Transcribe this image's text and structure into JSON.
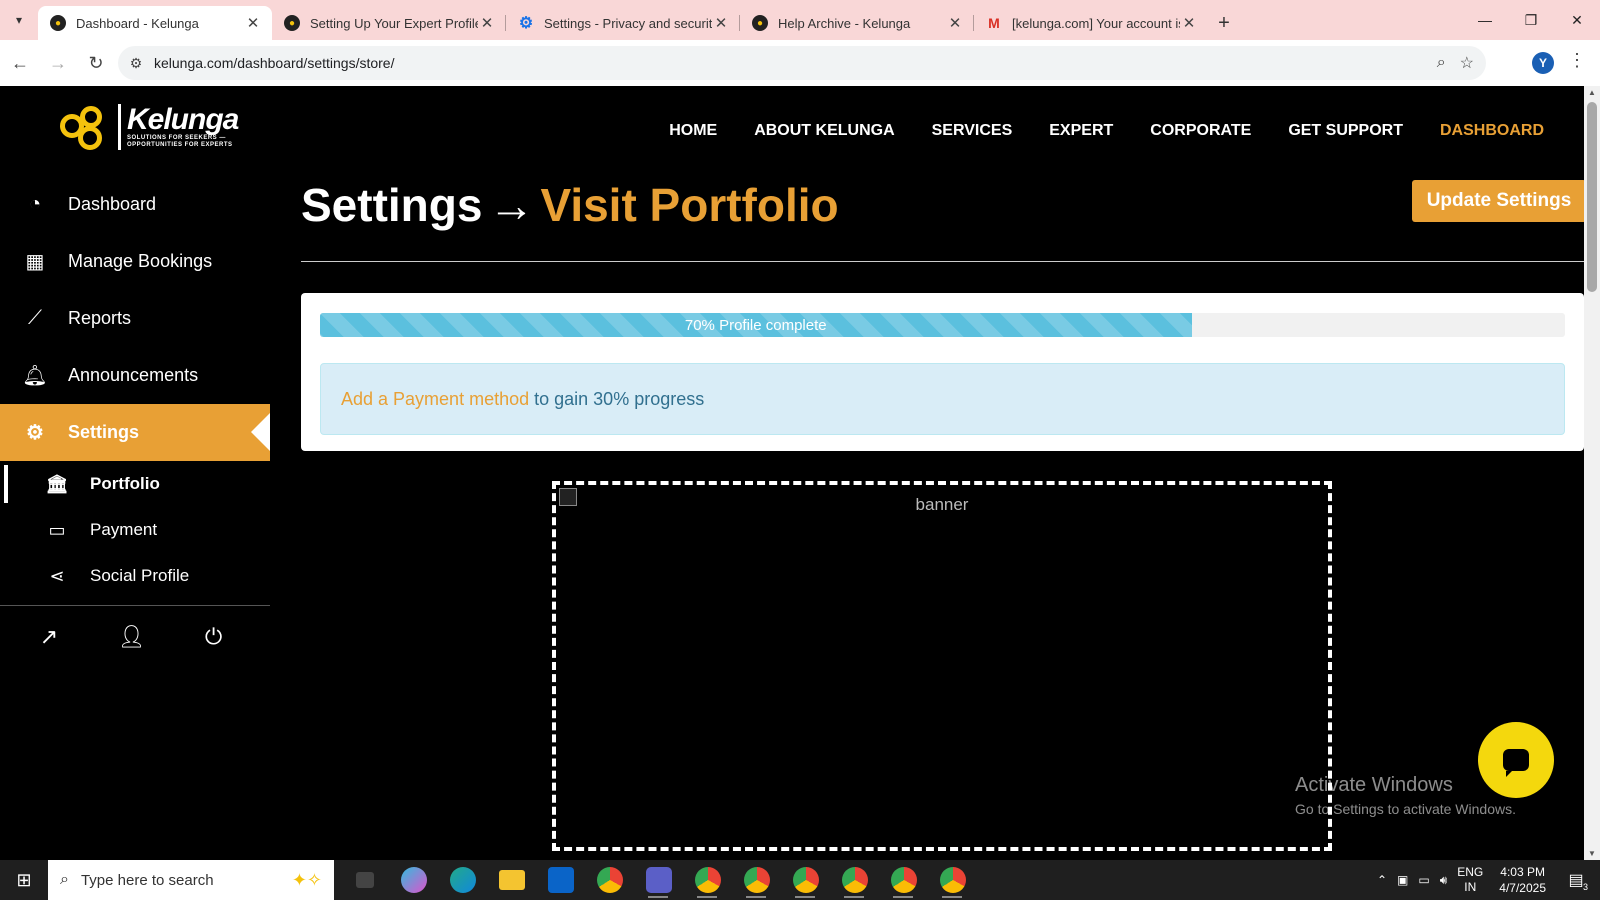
{
  "browser": {
    "tabs": [
      {
        "label": "Dashboard - Kelunga",
        "active": true,
        "favicon": "kelunga-icon"
      },
      {
        "label": "Setting Up Your Expert Profile -",
        "active": false,
        "favicon": "kelunga-icon"
      },
      {
        "label": "Settings - Privacy and security",
        "active": false,
        "favicon": "gear-icon"
      },
      {
        "label": "Help Archive - Kelunga",
        "active": false,
        "favicon": "kelunga-icon"
      },
      {
        "label": "[kelunga.com] Your account is a",
        "active": false,
        "favicon": "gmail-icon"
      }
    ],
    "url": "kelunga.com/dashboard/settings/store/",
    "profile_initial": "Y"
  },
  "site": {
    "logo_name": "Kelunga",
    "logo_tagline_1": "SOLUTIONS FOR SEEKERS —",
    "logo_tagline_2": "OPPORTUNITIES FOR EXPERTS",
    "nav": [
      {
        "label": "HOME",
        "active": false
      },
      {
        "label": "ABOUT KELUNGA",
        "active": false
      },
      {
        "label": "SERVICES",
        "active": false
      },
      {
        "label": "EXPERT",
        "active": false
      },
      {
        "label": "CORPORATE",
        "active": false
      },
      {
        "label": "GET SUPPORT",
        "active": false
      },
      {
        "label": "DASHBOARD",
        "active": true
      }
    ],
    "accent_color": "#e8a035"
  },
  "sidebar": {
    "items": [
      {
        "label": "Dashboard",
        "icon": "tachometer-icon"
      },
      {
        "label": "Manage Bookings",
        "icon": "calendar-icon"
      },
      {
        "label": "Reports",
        "icon": "line-chart-icon"
      },
      {
        "label": "Announcements",
        "icon": "bell-icon"
      },
      {
        "label": "Settings",
        "icon": "gear-icon",
        "active": true
      }
    ],
    "sub_items": [
      {
        "label": "Portfolio",
        "icon": "bank-icon",
        "active": true
      },
      {
        "label": "Payment",
        "icon": "credit-card-icon"
      },
      {
        "label": "Social Profile",
        "icon": "share-icon"
      }
    ]
  },
  "main": {
    "title_prefix": "Settings",
    "title_arrow": "→",
    "title_accent": "Visit Portfolio",
    "update_button": "Update Settings",
    "progress": {
      "percent": 70,
      "label": "70% Profile complete"
    },
    "alert": {
      "link_text": "Add a Payment method",
      "rest_text": "to gain 30% progress"
    },
    "banner_alt": "banner"
  },
  "watermark": {
    "line1": "Activate Windows",
    "line2": "Go to Settings to activate Windows."
  },
  "taskbar": {
    "search_placeholder": "Type here to search",
    "lang_1": "ENG",
    "lang_2": "IN",
    "time": "4:03 PM",
    "date": "4/7/2025",
    "notification_count": "3"
  }
}
